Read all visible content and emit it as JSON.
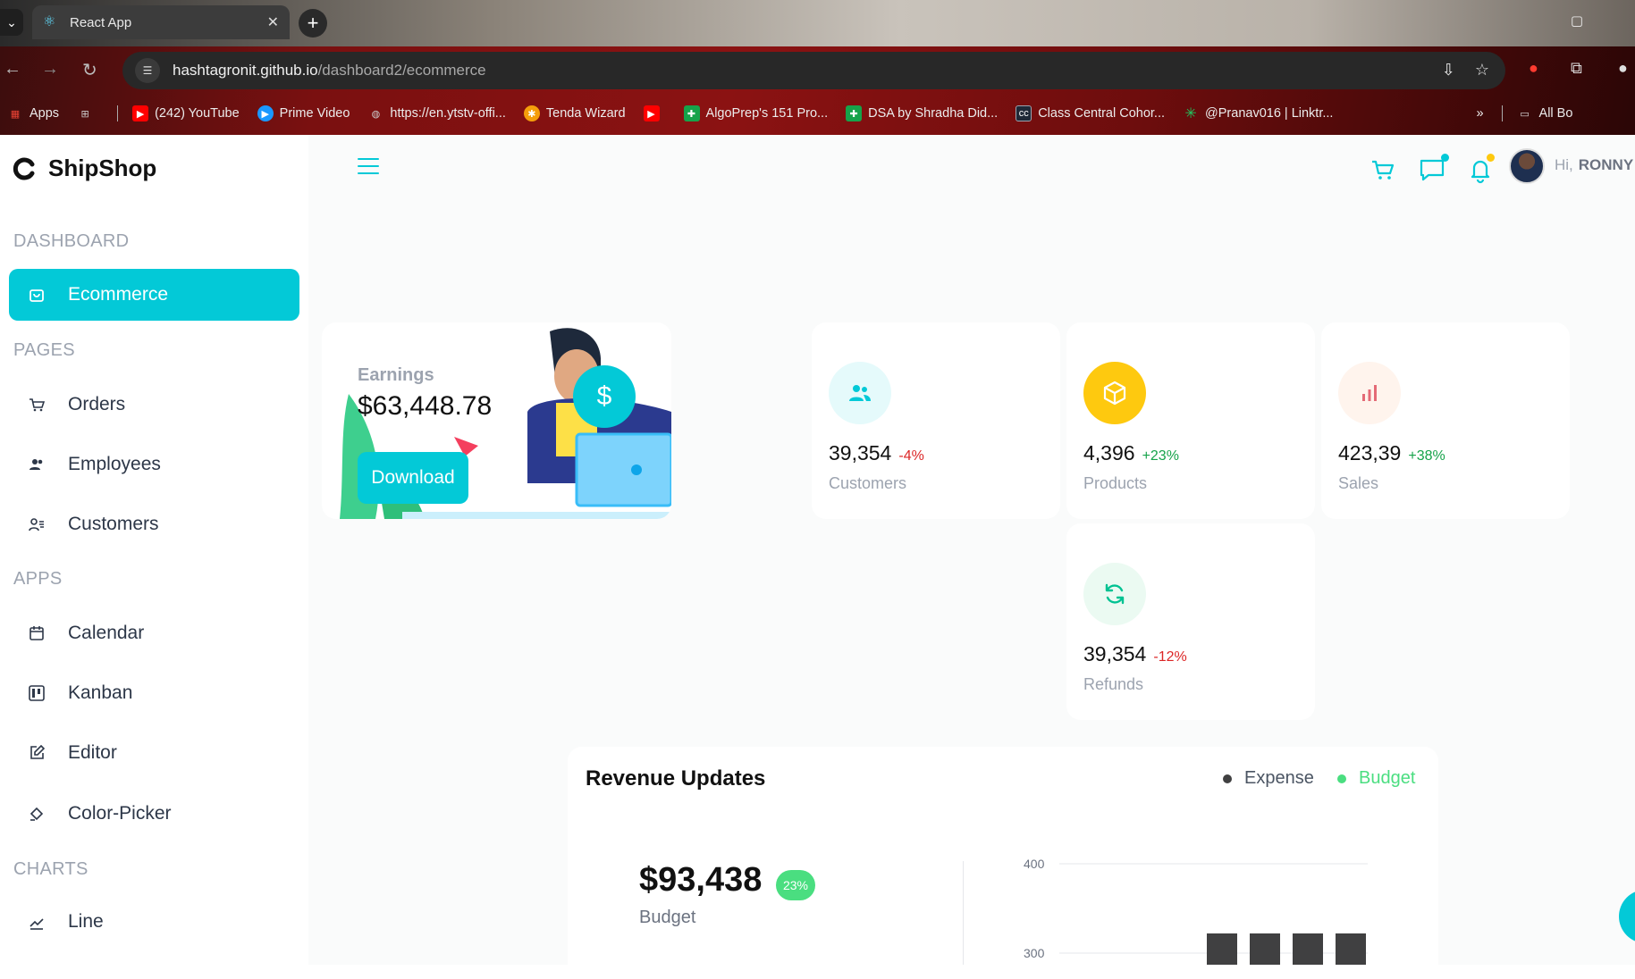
{
  "browser": {
    "tab_title": "React App",
    "url_host": "hashtagronit.github.io",
    "url_path": "/dashboard2/ecommerce",
    "bookmarks": [
      {
        "label": "Apps",
        "color": "#ea4335"
      },
      {
        "label": "(242) YouTube",
        "color": "#ff0000"
      },
      {
        "label": "Prime Video",
        "color": "#1a98ff"
      },
      {
        "label": "https://en.ytstv-offi...",
        "color": "#8a8a8a"
      },
      {
        "label": "Tenda Wizard",
        "color": "#f59e0b"
      },
      {
        "label": "",
        "color": "#ff0000"
      },
      {
        "label": "AlgoPrep's 151 Pro...",
        "color": "#16a34a"
      },
      {
        "label": "DSA by Shradha Did...",
        "color": "#16a34a"
      },
      {
        "label": "Class Central Cohor...",
        "color": "#4b5563"
      },
      {
        "label": "@Pranav016 | Linktr...",
        "color": "#22c55e"
      }
    ],
    "all_bookmarks": "All Bo"
  },
  "app": {
    "brand": "ShipShop",
    "accent": "#03c9d7",
    "sidebar": {
      "sections": {
        "dashboard": "DASHBOARD",
        "pages": "PAGES",
        "apps": "APPS",
        "charts": "CHARTS"
      },
      "items": {
        "ecommerce": "Ecommerce",
        "orders": "Orders",
        "employees": "Employees",
        "customers": "Customers",
        "calendar": "Calendar",
        "kanban": "Kanban",
        "editor": "Editor",
        "color_picker": "Color-Picker",
        "line": "Line"
      }
    },
    "header": {
      "greeting": "Hi,",
      "user": "RONNY"
    },
    "earnings": {
      "label": "Earnings",
      "value": "$63,448.78",
      "button": "Download"
    },
    "stats": {
      "customers": {
        "value": "39,354",
        "change": "-4%",
        "label": "Customers",
        "icon_bg": "#e5fafb",
        "icon_color": "#03c9d7"
      },
      "products": {
        "value": "4,396",
        "change": "+23%",
        "label": "Products",
        "icon_bg": "#fec90f",
        "icon_color": "#ffffff"
      },
      "sales": {
        "value": "423,39",
        "change": "+38%",
        "label": "Sales",
        "icon_bg": "#fff4ed",
        "icon_color": "#e46a76"
      },
      "refunds": {
        "value": "39,354",
        "change": "-12%",
        "label": "Refunds",
        "icon_bg": "#ebfaf2",
        "icon_color": "#00c292"
      }
    },
    "revenue": {
      "title": "Revenue Updates",
      "legend_expense": "Expense",
      "legend_budget": "Budget",
      "budget_value": "$93,438",
      "budget_badge": "23%",
      "budget_label": "Budget"
    }
  },
  "chart_data": {
    "type": "bar",
    "y_ticks": [
      400,
      300
    ],
    "series": [
      {
        "name": "Expense",
        "values": [
          300,
          300,
          300,
          300
        ],
        "color": "#404041"
      }
    ]
  }
}
